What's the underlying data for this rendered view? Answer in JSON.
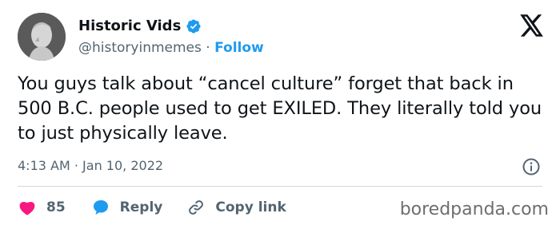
{
  "author": {
    "name": "Historic Vids",
    "handle": "@historyinmemes",
    "separator": "·",
    "follow_label": "Follow",
    "verified": true
  },
  "tweet": {
    "text": "You guys talk about “cancel culture” forget that back in 500 B.C. people used to get EXILED. They literally told you to just physically leave.",
    "time": "4:13 AM",
    "date_separator": "·",
    "date": "Jan 10, 2022"
  },
  "actions": {
    "likes_count": "85",
    "reply_label": "Reply",
    "copy_link_label": "Copy link"
  },
  "icons": [
    "avatar-portrait",
    "verified-badge-icon",
    "x-logo-icon",
    "info-icon",
    "heart-icon",
    "reply-bubble-icon",
    "link-icon"
  ],
  "colors": {
    "accent": "#1d9bf0",
    "text": "#0f1419",
    "secondary_text": "#536471",
    "heart": "#f91880",
    "divider": "#cfd9de"
  },
  "watermark": "boredpanda.com"
}
